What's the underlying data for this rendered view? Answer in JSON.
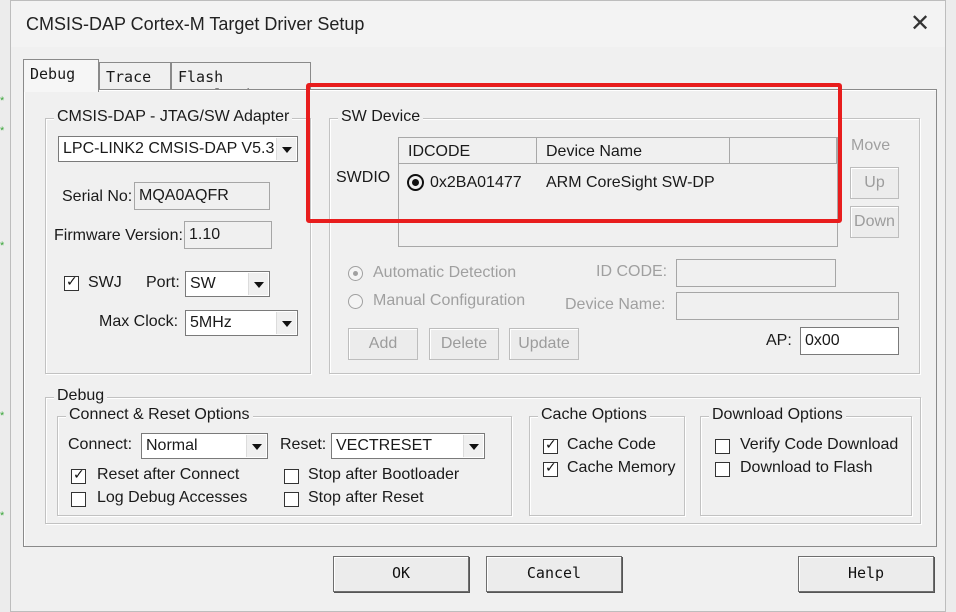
{
  "window": {
    "title": "CMSIS-DAP Cortex-M Target Driver Setup",
    "close_glyph": "✕"
  },
  "tabs": [
    {
      "label": "Debug"
    },
    {
      "label": "Trace"
    },
    {
      "label": "Flash Download"
    }
  ],
  "adapter": {
    "legend": "CMSIS-DAP - JTAG/SW Adapter",
    "selected": "LPC-LINK2 CMSIS-DAP V5.3",
    "serial_label": "Serial No:",
    "serial_value": "MQA0AQFR",
    "firmware_label": "Firmware Version:",
    "firmware_value": "1.10",
    "swj_label": "SWJ",
    "swj_checked": true,
    "port_label": "Port:",
    "port_value": "SW",
    "maxclock_label": "Max Clock:",
    "maxclock_value": "5MHz"
  },
  "sw_device": {
    "legend": "SW Device",
    "row_label": "SWDIO",
    "columns": [
      "IDCODE",
      "Device Name"
    ],
    "rows": [
      {
        "idcode": "0x2BA01477",
        "name": "ARM CoreSight SW-DP"
      }
    ],
    "move_label": "Move",
    "up_label": "Up",
    "down_label": "Down",
    "auto_detect_label": "Automatic Detection",
    "manual_config_label": "Manual Configuration",
    "idcode_field_label": "ID CODE:",
    "device_name_field_label": "Device Name:",
    "add_label": "Add",
    "delete_label": "Delete",
    "update_label": "Update",
    "ap_label": "AP:",
    "ap_value": "0x00"
  },
  "debug": {
    "legend": "Debug",
    "connect_reset": {
      "legend": "Connect & Reset Options",
      "connect_label": "Connect:",
      "connect_value": "Normal",
      "reset_label": "Reset:",
      "reset_value": "VECTRESET",
      "reset_after_connect": {
        "label": "Reset after Connect",
        "checked": true
      },
      "stop_after_bootloader": {
        "label": "Stop after Bootloader",
        "checked": false
      },
      "log_debug_accesses": {
        "label": "Log Debug Accesses",
        "checked": false
      },
      "stop_after_reset": {
        "label": "Stop after Reset",
        "checked": false
      }
    },
    "cache": {
      "legend": "Cache Options",
      "cache_code": {
        "label": "Cache Code",
        "checked": true
      },
      "cache_memory": {
        "label": "Cache Memory",
        "checked": true
      }
    },
    "download": {
      "legend": "Download Options",
      "verify": {
        "label": "Verify Code Download",
        "checked": false
      },
      "to_flash": {
        "label": "Download to Flash",
        "checked": false
      }
    }
  },
  "buttons": {
    "ok": "OK",
    "cancel": "Cancel",
    "help": "Help"
  },
  "colors": {
    "highlight": "#e81d1d",
    "window_bg": "#f0f0f0"
  }
}
